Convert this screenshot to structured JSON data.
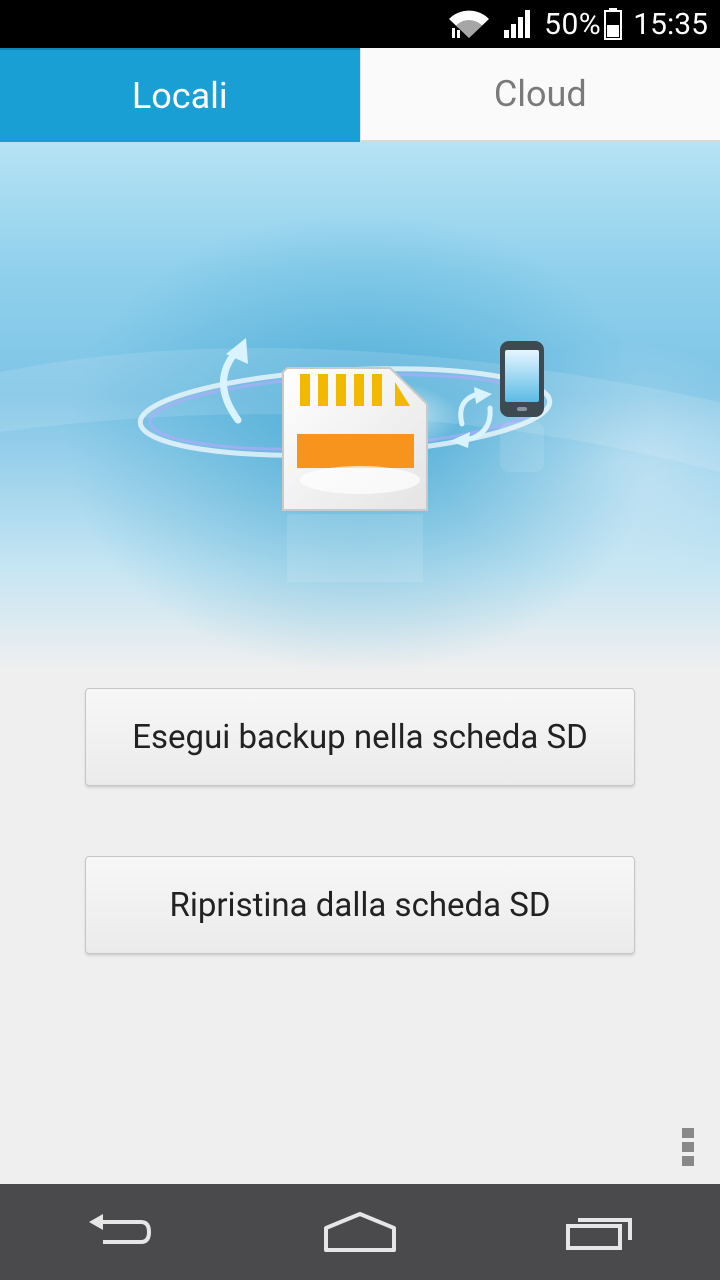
{
  "status_bar": {
    "battery_percent": "50%",
    "time": "15:35",
    "icons": [
      "wifi-icon",
      "signal-icon",
      "battery-icon"
    ]
  },
  "tabs": [
    {
      "label": "Locali",
      "active": true
    },
    {
      "label": "Cloud",
      "active": false
    }
  ],
  "hero": {
    "illustration": "sd-card-sync-illustration",
    "icons": [
      "sd-card-icon",
      "phone-icon",
      "sync-arrow-icon"
    ]
  },
  "actions": {
    "backup_label": "Esegui backup nella scheda SD",
    "restore_label": "Ripristina dalla scheda SD"
  },
  "menu": {
    "icon": "overflow-menu-icon"
  },
  "nav_bar": {
    "icons": [
      "back-icon",
      "home-icon",
      "recent-apps-icon"
    ]
  },
  "colors": {
    "accent": "#1a9fd4",
    "status_bar": "#000000",
    "nav_bar": "#4a4a4c",
    "background": "#efefef"
  }
}
